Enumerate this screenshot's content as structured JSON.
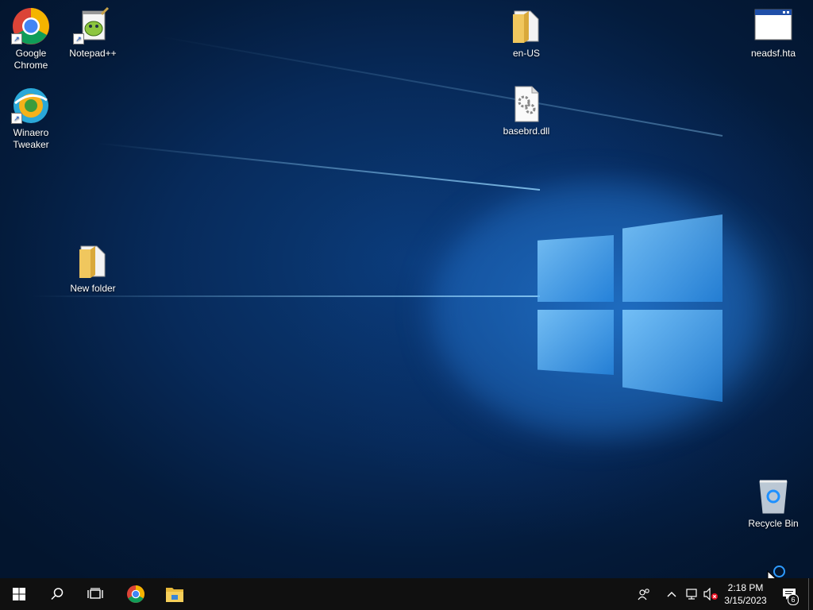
{
  "desktop": {
    "icons": [
      {
        "id": "chrome",
        "label": "Google Chrome"
      },
      {
        "id": "notepadpp",
        "label": "Notepad++"
      },
      {
        "id": "enus",
        "label": "en-US"
      },
      {
        "id": "neadsf",
        "label": "neadsf.hta"
      },
      {
        "id": "winaero",
        "label": "Winaero Tweaker"
      },
      {
        "id": "basebrd",
        "label": "basebrd.dll"
      },
      {
        "id": "newfolder",
        "label": "New folder"
      },
      {
        "id": "recycle",
        "label": "Recycle Bin"
      }
    ]
  },
  "taskbar": {
    "start": "start-icon",
    "search": "search-icon",
    "task_view": "task-view-icon",
    "pinned": [
      "chrome-icon",
      "file-explorer-icon"
    ],
    "tray": {
      "people": "people-icon",
      "show_hidden": "chevron-up-icon",
      "network": "network-icon",
      "volume": "volume-muted-icon",
      "time": "2:18 PM",
      "date": "3/15/2023",
      "notifications_count": "6"
    }
  },
  "colors": {
    "taskbar": "#101010",
    "accent": "#0078d7",
    "desktop_bg": "#072a5a"
  }
}
